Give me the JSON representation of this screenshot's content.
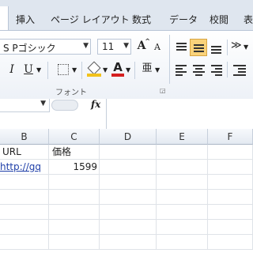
{
  "ribbon_tabs": [
    "挿入",
    "ページ レイアウト",
    "数式",
    "データ",
    "校閲",
    "表示"
  ],
  "font": {
    "name": "S Pゴシック",
    "size": "11"
  },
  "buttons": {
    "grow": "A",
    "shrink": "A",
    "italic": "I",
    "underline": "U",
    "phonetic": "亜"
  },
  "groups": {
    "font": "フォント"
  },
  "formula_bar": {
    "fx": "fx",
    "value": ""
  },
  "columns": [
    "B",
    "C",
    "D",
    "E",
    "F"
  ],
  "rows": [
    {
      "B": "URL",
      "C": "価格",
      "D": "",
      "E": "",
      "F": ""
    },
    {
      "B": "http://gq",
      "C": "1599",
      "D": "",
      "E": "",
      "F": ""
    }
  ],
  "colors": {
    "fill": "#f2c21b",
    "font": "#d42020",
    "active_align": "#f9d27a"
  }
}
